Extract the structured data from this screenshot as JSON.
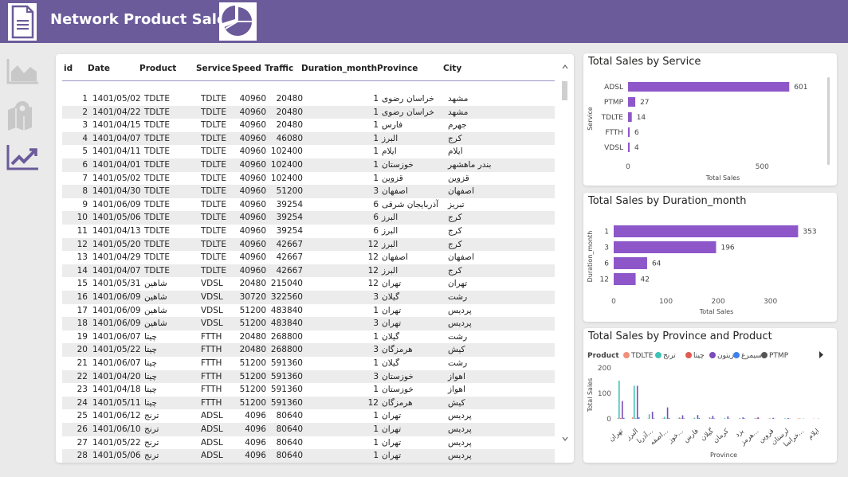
{
  "header": {
    "title": "Network Product Sales"
  },
  "icons": {
    "doc": "document-icon",
    "pie": "pie-chart-icon",
    "area": "area-chart-icon",
    "map": "map-icon",
    "trend": "trend-chart-icon"
  },
  "colors": {
    "header": "#6b5b9a",
    "bar": "#8e57c9",
    "accent": "#7a4bb8"
  },
  "table": {
    "columns": [
      "id",
      "Date",
      "Product",
      "Service",
      "Speed",
      "Traffic",
      "Duration_month",
      "Province",
      "City"
    ],
    "rows": [
      [
        "1",
        "1401/05/02",
        "TDLTE",
        "TDLTE",
        "40960",
        "20480",
        "1",
        "خراسان رضوی",
        "مشهد"
      ],
      [
        "2",
        "1401/04/22",
        "TDLTE",
        "TDLTE",
        "40960",
        "20480",
        "1",
        "خراسان رضوی",
        "مشهد"
      ],
      [
        "3",
        "1401/04/15",
        "TDLTE",
        "TDLTE",
        "40960",
        "20480",
        "1",
        "فارس",
        "جهرم"
      ],
      [
        "4",
        "1401/04/07",
        "TDLTE",
        "TDLTE",
        "40960",
        "46080",
        "1",
        "البرز",
        "کرج"
      ],
      [
        "5",
        "1401/04/11",
        "TDLTE",
        "TDLTE",
        "40960",
        "102400",
        "1",
        "ایلام",
        "ایلام"
      ],
      [
        "6",
        "1401/04/01",
        "TDLTE",
        "TDLTE",
        "40960",
        "102400",
        "1",
        "خوزستان",
        "بندر ماهشهر"
      ],
      [
        "7",
        "1401/05/02",
        "TDLTE",
        "TDLTE",
        "40960",
        "102400",
        "1",
        "قزوین",
        "قزوین"
      ],
      [
        "8",
        "1401/04/30",
        "TDLTE",
        "TDLTE",
        "40960",
        "51200",
        "3",
        "اصفهان",
        "اصفهان"
      ],
      [
        "9",
        "1401/06/09",
        "TDLTE",
        "TDLTE",
        "40960",
        "39254",
        "6",
        "آذربایجان شرقی",
        "تبریز"
      ],
      [
        "10",
        "1401/05/06",
        "TDLTE",
        "TDLTE",
        "40960",
        "39254",
        "6",
        "البرز",
        "کرج"
      ],
      [
        "11",
        "1401/04/13",
        "TDLTE",
        "TDLTE",
        "40960",
        "39254",
        "6",
        "البرز",
        "کرج"
      ],
      [
        "12",
        "1401/05/20",
        "TDLTE",
        "TDLTE",
        "40960",
        "42667",
        "12",
        "البرز",
        "کرج"
      ],
      [
        "13",
        "1401/04/29",
        "TDLTE",
        "TDLTE",
        "40960",
        "42667",
        "12",
        "اصفهان",
        "اصفهان"
      ],
      [
        "14",
        "1401/04/07",
        "TDLTE",
        "TDLTE",
        "40960",
        "42667",
        "12",
        "البرز",
        "کرج"
      ],
      [
        "15",
        "1401/05/31",
        "شاهین",
        "VDSL",
        "20480",
        "215040",
        "12",
        "تهران",
        "تهران"
      ],
      [
        "16",
        "1401/06/09",
        "شاهین",
        "VDSL",
        "30720",
        "322560",
        "3",
        "گیلان",
        "رشت"
      ],
      [
        "17",
        "1401/06/09",
        "شاهین",
        "VDSL",
        "51200",
        "483840",
        "1",
        "تهران",
        "پردیس"
      ],
      [
        "18",
        "1401/06/09",
        "شاهین",
        "VDSL",
        "51200",
        "483840",
        "3",
        "تهران",
        "پردیس"
      ],
      [
        "19",
        "1401/06/07",
        "چیتا",
        "FTTH",
        "20480",
        "268800",
        "1",
        "گیلان",
        "رشت"
      ],
      [
        "20",
        "1401/05/22",
        "چیتا",
        "FTTH",
        "20480",
        "268800",
        "3",
        "هرمزگان",
        "کیش"
      ],
      [
        "21",
        "1401/06/07",
        "چیتا",
        "FTTH",
        "51200",
        "591360",
        "1",
        "گیلان",
        "رشت"
      ],
      [
        "22",
        "1401/04/20",
        "چیتا",
        "FTTH",
        "51200",
        "591360",
        "3",
        "خوزستان",
        "اهواز"
      ],
      [
        "23",
        "1401/04/18",
        "چیتا",
        "FTTH",
        "51200",
        "591360",
        "1",
        "خوزستان",
        "اهواز"
      ],
      [
        "24",
        "1401/05/11",
        "چیتا",
        "FTTH",
        "51200",
        "591360",
        "12",
        "هرمزگان",
        "کیش"
      ],
      [
        "25",
        "1401/06/12",
        "ترنج",
        "ADSL",
        "4096",
        "80640",
        "1",
        "تهران",
        "پردیس"
      ],
      [
        "26",
        "1401/06/10",
        "ترنج",
        "ADSL",
        "4096",
        "80640",
        "1",
        "تهران",
        "پردیس"
      ],
      [
        "27",
        "1401/05/22",
        "ترنج",
        "ADSL",
        "4096",
        "80640",
        "1",
        "تهران",
        "پردیس"
      ],
      [
        "28",
        "1401/05/06",
        "ترنج",
        "ADSL",
        "4096",
        "80640",
        "1",
        "تهران",
        "پردیس"
      ]
    ]
  },
  "chart_data": [
    {
      "type": "bar",
      "orientation": "horizontal",
      "title": "Total Sales by Service",
      "xlabel": "Total Sales",
      "ylabel": "Service",
      "categories": [
        "ADSL",
        "PTMP",
        "TDLTE",
        "FTTH",
        "VDSL"
      ],
      "values": [
        601,
        27,
        14,
        6,
        4
      ],
      "xticks": [
        "0",
        "500"
      ],
      "xlim": [
        0,
        700
      ]
    },
    {
      "type": "bar",
      "orientation": "horizontal",
      "title": "Total Sales by Duration_month",
      "xlabel": "Total Sales",
      "ylabel": "Duration_month",
      "categories": [
        "1",
        "3",
        "6",
        "12"
      ],
      "values": [
        353,
        196,
        64,
        42
      ],
      "xticks": [
        "0",
        "100",
        "200",
        "300"
      ],
      "xlim": [
        0,
        360
      ]
    },
    {
      "type": "bar",
      "title": "Total Sales by Province and Product",
      "xlabel": "Province",
      "ylabel": "Total Sales",
      "legend_title": "Product",
      "yticks": [
        "0",
        "100",
        "200"
      ],
      "ylim": [
        0,
        200
      ],
      "categories": [
        "تهران",
        "البرز",
        "آذربا...",
        "اصفه...",
        "خوز...",
        "فارس",
        "گیلان",
        "کرمان",
        "یزد",
        "هرمز...",
        "قزوین",
        "لرستان",
        "خراسا...",
        "ایلام"
      ],
      "series": [
        {
          "name": "TDLTE",
          "color": "#f0907a",
          "values": [
            2,
            6,
            1,
            2,
            1,
            1,
            0,
            0,
            0,
            0,
            1,
            0,
            2,
            1
          ]
        },
        {
          "name": "ترنج",
          "color": "#3fc3b5",
          "values": [
            150,
            130,
            18,
            8,
            6,
            4,
            6,
            3,
            3,
            2,
            2,
            2,
            1,
            0
          ]
        },
        {
          "name": "چیتا",
          "color": "#e05a52",
          "values": [
            3,
            2,
            0,
            1,
            2,
            0,
            2,
            0,
            0,
            2,
            0,
            0,
            0,
            0
          ]
        },
        {
          "name": "زیتون",
          "color": "#7a4bb8",
          "values": [
            70,
            130,
            28,
            45,
            14,
            15,
            12,
            10,
            6,
            6,
            4,
            3,
            1,
            1
          ]
        },
        {
          "name": "سیمرغ",
          "color": "#3f80f0",
          "values": [
            4,
            6,
            2,
            3,
            2,
            3,
            2,
            1,
            2,
            1,
            1,
            1,
            0,
            0
          ]
        },
        {
          "name": "PTMP",
          "color": "#555555",
          "values": [
            0,
            0,
            0,
            0,
            0,
            0,
            0,
            0,
            0,
            0,
            0,
            0,
            0,
            0
          ]
        }
      ]
    }
  ]
}
